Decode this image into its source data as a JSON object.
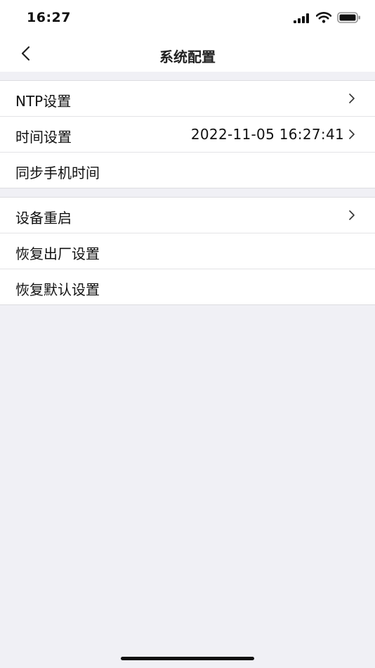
{
  "status_bar": {
    "time": "16:27",
    "icons": [
      "signal-icon",
      "wifi-icon",
      "battery-icon"
    ]
  },
  "nav": {
    "title": "系统配置",
    "back_icon": "chevron-left-icon"
  },
  "groups": [
    {
      "rows": [
        {
          "label": "NTP设置",
          "value": "",
          "chevron": true
        },
        {
          "label": "时间设置",
          "value": "2022-11-05 16:27:41",
          "chevron": true
        },
        {
          "label": "同步手机时间",
          "value": "",
          "chevron": false
        }
      ]
    },
    {
      "rows": [
        {
          "label": "设备重启",
          "value": "",
          "chevron": true
        },
        {
          "label": "恢复出厂设置",
          "value": "",
          "chevron": false
        },
        {
          "label": "恢复默认设置",
          "value": "",
          "chevron": false
        }
      ]
    }
  ],
  "colors": {
    "background": "#f0f0f5",
    "surface": "#ffffff",
    "text": "#111111",
    "separator": "#e3e3e6"
  }
}
